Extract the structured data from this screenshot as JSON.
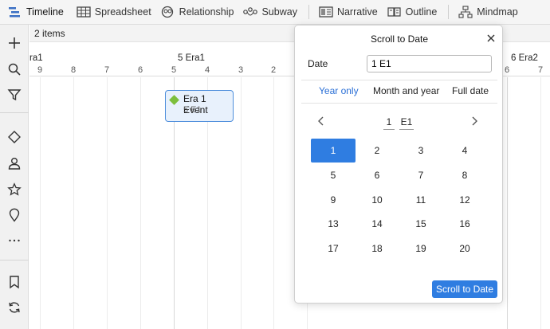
{
  "toolbar": {
    "tabs": [
      {
        "label": "Timeline",
        "icon": "timeline-icon"
      },
      {
        "label": "Spreadsheet",
        "icon": "spreadsheet-icon"
      },
      {
        "label": "Relationship",
        "icon": "relationship-icon"
      },
      {
        "label": "Subway",
        "icon": "subway-icon"
      },
      {
        "label": "Narrative",
        "icon": "narrative-icon"
      },
      {
        "label": "Outline",
        "icon": "outline-icon"
      },
      {
        "label": "Mindmap",
        "icon": "mindmap-icon"
      }
    ],
    "active_tab": "Timeline"
  },
  "sidebar": {
    "icons": [
      "plus-icon",
      "search-icon",
      "filter-icon",
      "diamond-icon",
      "person-icon",
      "star-icon",
      "location-pin-icon",
      "more-icon",
      "bookmark-icon",
      "refresh-icon"
    ]
  },
  "main": {
    "items_count": "2 items",
    "ruler": {
      "eras": [
        "ra1",
        "5 Era1",
        "6 Era2"
      ],
      "ticks": [
        "9",
        "8",
        "7",
        "6",
        "5",
        "4",
        "3",
        "2",
        "6",
        "7"
      ]
    },
    "event": {
      "title": "Era 1 Event",
      "date": "5 E1",
      "marker_color": "#7cbf3c"
    }
  },
  "popup": {
    "title": "Scroll to Date",
    "date_label": "Date",
    "date_value": "1 E1",
    "tabs": [
      "Year only",
      "Month and year",
      "Full date"
    ],
    "active_tab": "Year only",
    "selector": {
      "year": "1",
      "era": "E1"
    },
    "grid": [
      "1",
      "2",
      "3",
      "4",
      "5",
      "6",
      "7",
      "8",
      "9",
      "10",
      "11",
      "12",
      "13",
      "14",
      "15",
      "16",
      "17",
      "18",
      "19",
      "20"
    ],
    "selected": "1",
    "button_label": "Scroll to Date"
  },
  "colors": {
    "accent": "#2f7de1",
    "event_fill": "#e8f1fc",
    "event_border": "#4f8fdc"
  }
}
